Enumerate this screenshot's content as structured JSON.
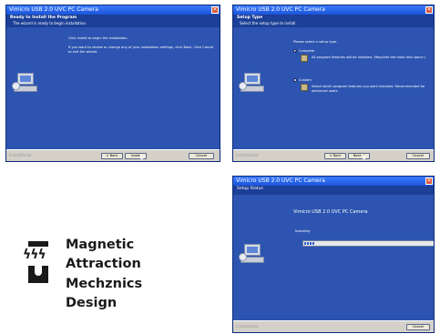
{
  "common": {
    "window_title": "Vimicro USB 2.0 UVC PC Camera",
    "close_glyph": "✕",
    "brand": "InstallShield",
    "back": "< Back",
    "next": "Next >",
    "install": "Install",
    "cancel": "Cancel"
  },
  "win1": {
    "header_title": "Ready to Install the Program",
    "header_sub": "The wizard is ready to begin installation.",
    "line1": "Click Install to begin the installation.",
    "line2": "If you want to review or change any of your installation settings, click Back. Click Cancel to exit the wizard."
  },
  "win2": {
    "header_title": "Setup Type",
    "header_sub": "Select the setup type to install.",
    "prompt": "Please select a setup type.",
    "complete_label": "Complete",
    "complete_desc": "All program features will be installed. (Requires the most disk space.)",
    "custom_label": "Custom",
    "custom_desc": "Select which program features you want installed. Recommended for advanced users."
  },
  "win3": {
    "header_title": "Setup Status",
    "heading": "Vimicro USB 2.0 UVC PC Camera",
    "status": "Installing",
    "progress": 0.08
  },
  "logo": {
    "line1": "Magnetic",
    "line2": "Attraction",
    "line3": "Mechznics",
    "line4": "Design",
    "arrows": "ϟϟϟ"
  },
  "colors": {
    "window_body": "#2c54b0",
    "titlebar": "#1b54d8",
    "header": "#1c3f97",
    "footer": "#d4d0c8"
  }
}
